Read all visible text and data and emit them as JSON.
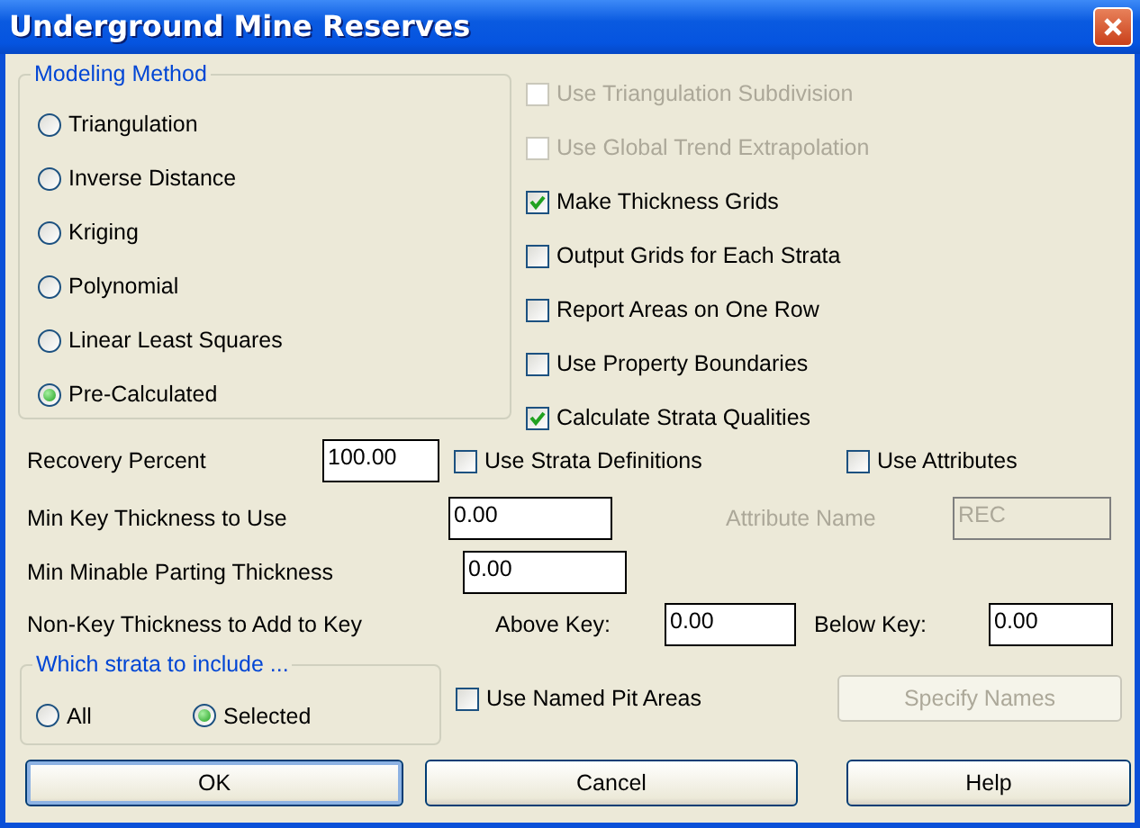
{
  "window": {
    "title": "Underground Mine Reserves"
  },
  "modeling_method": {
    "title": "Modeling Method",
    "options": [
      {
        "label": "Triangulation",
        "selected": false
      },
      {
        "label": "Inverse Distance",
        "selected": false
      },
      {
        "label": "Kriging",
        "selected": false
      },
      {
        "label": "Polynomial",
        "selected": false
      },
      {
        "label": "Linear Least Squares",
        "selected": false
      },
      {
        "label": "Pre-Calculated",
        "selected": true
      }
    ]
  },
  "options": [
    {
      "label": "Use Triangulation Subdivision",
      "checked": false,
      "disabled": true
    },
    {
      "label": "Use Global Trend Extrapolation",
      "checked": false,
      "disabled": true
    },
    {
      "label": "Make Thickness Grids",
      "checked": true,
      "disabled": false
    },
    {
      "label": "Output Grids for Each Strata",
      "checked": false,
      "disabled": false
    },
    {
      "label": "Report Areas on One Row",
      "checked": false,
      "disabled": false
    },
    {
      "label": "Use Property Boundaries",
      "checked": false,
      "disabled": false
    },
    {
      "label": "Calculate Strata Qualities",
      "checked": true,
      "disabled": false
    }
  ],
  "recovery_percent": {
    "label": "Recovery Percent",
    "value": "100.00"
  },
  "use_strata_definitions": {
    "label": "Use Strata Definitions",
    "checked": false
  },
  "use_attributes": {
    "label": "Use Attributes",
    "checked": false
  },
  "min_key_thickness": {
    "label": "Min Key Thickness to Use",
    "value": "0.00"
  },
  "attribute_name": {
    "label": "Attribute Name",
    "value": "REC",
    "disabled": true
  },
  "min_parting": {
    "label": "Min Minable Parting Thickness",
    "value": "0.00"
  },
  "non_key": {
    "label": "Non-Key Thickness to Add to Key",
    "above_label": "Above Key:",
    "above_value": "0.00",
    "below_label": "Below Key:",
    "below_value": "0.00"
  },
  "strata_include": {
    "title": "Which strata to include ...",
    "options": [
      {
        "label": "All",
        "selected": false
      },
      {
        "label": "Selected",
        "selected": true
      }
    ]
  },
  "use_named_pit_areas": {
    "label": "Use Named Pit Areas",
    "checked": false
  },
  "specify_names": {
    "label": "Specify Names",
    "disabled": true
  },
  "buttons": [
    {
      "label": "OK",
      "default": true
    },
    {
      "label": "Cancel",
      "default": false
    },
    {
      "label": "Help",
      "default": false
    }
  ]
}
